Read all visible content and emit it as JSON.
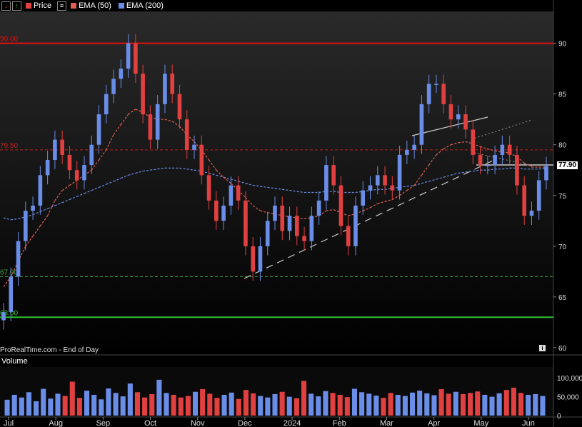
{
  "header": {
    "price_label": "Price",
    "ema50_label": "EMA (50)",
    "ema200_label": "EMA (200)",
    "colors": {
      "price": "#e04040",
      "ema50": "#e06050",
      "ema200": "#6a8de8"
    }
  },
  "volume_panel": {
    "label": "Volume",
    "ticks": [
      "100,000",
      "50,000",
      "0"
    ]
  },
  "footer": {
    "source": "ProRealTime.com - End of Day"
  },
  "levels": [
    {
      "label": "90.00",
      "value": 90.0,
      "color": "#e01010",
      "style": "solid"
    },
    {
      "label": "79.50",
      "value": 79.5,
      "color": "#c02020",
      "style": "dashed"
    },
    {
      "label": "67.00",
      "value": 67.0,
      "color": "#40a040",
      "style": "dashed"
    },
    {
      "label": "63.00",
      "value": 63.0,
      "color": "#30c030",
      "style": "solid"
    }
  ],
  "current_price": "77.90",
  "chart_data": {
    "type": "line",
    "x_labels": [
      "Jul",
      "Aug",
      "Sep",
      "Oct",
      "Nov",
      "Dec",
      "2024",
      "Feb",
      "Mar",
      "Apr",
      "May",
      "Jun"
    ],
    "y_ticks": [
      90,
      85,
      80,
      75,
      70,
      65,
      60
    ],
    "ylim": [
      59.5,
      93
    ],
    "series": [
      {
        "name": "Price",
        "color": "#e04040",
        "values": [
          63.5,
          67,
          70.5,
          73.5,
          74,
          77,
          78.5,
          80.5,
          79,
          77.5,
          76.5,
          78,
          80,
          83,
          85,
          86.5,
          87.5,
          90,
          87,
          83,
          80.5,
          84,
          87,
          85,
          82.5,
          79.5,
          80,
          77,
          74.5,
          72.5,
          74,
          76,
          74.5,
          70,
          67.5,
          70,
          72.5,
          74,
          71.5,
          73,
          71,
          70.5,
          73,
          74.5,
          78,
          76,
          72,
          70,
          74,
          75.5,
          76,
          77,
          76,
          75.5,
          79,
          79.5,
          80,
          84,
          86,
          86,
          84,
          82.5,
          83,
          81.5,
          79,
          78,
          78,
          79,
          80,
          79,
          76,
          73,
          73.5,
          76.5,
          77.9
        ]
      },
      {
        "name": "EMA (50)",
        "color": "#e06050",
        "values": [
          66,
          67,
          68.5,
          70,
          71,
          72,
          73,
          74.5,
          75.5,
          76,
          76.5,
          77,
          77.5,
          78.5,
          79.5,
          81,
          82,
          83,
          83.5,
          83.2,
          82.7,
          82.5,
          82.5,
          82.3,
          81.8,
          81,
          80.3,
          79.5,
          78.5,
          77.5,
          76.8,
          76.2,
          75.5,
          74.8,
          74,
          73.5,
          73.3,
          73.2,
          73,
          72.9,
          72.8,
          72.7,
          72.8,
          73,
          73.5,
          73.6,
          73.3,
          73,
          73.2,
          73.5,
          73.8,
          74.2,
          74.4,
          74.6,
          75,
          75.5,
          76,
          77,
          78,
          79,
          79.6,
          80,
          80.2,
          80.3,
          80.1,
          79.8,
          79.6,
          79.4,
          79.3,
          79.2,
          78.8,
          78.2,
          77.8,
          77.8,
          77.8
        ]
      },
      {
        "name": "EMA (200)",
        "color": "#6a8de8",
        "values": [
          72.8,
          72.6,
          72.7,
          72.9,
          73.1,
          73.4,
          73.7,
          74,
          74.3,
          74.6,
          74.9,
          75.2,
          75.5,
          75.8,
          76.1,
          76.4,
          76.7,
          77,
          77.2,
          77.4,
          77.5,
          77.6,
          77.7,
          77.7,
          77.7,
          77.6,
          77.5,
          77.4,
          77.2,
          77,
          76.8,
          76.6,
          76.4,
          76.2,
          76,
          75.9,
          75.8,
          75.7,
          75.6,
          75.5,
          75.4,
          75.3,
          75.3,
          75.3,
          75.4,
          75.4,
          75.3,
          75.3,
          75.3,
          75.4,
          75.5,
          75.6,
          75.6,
          75.7,
          75.8,
          75.9,
          76,
          76.2,
          76.4,
          76.6,
          76.8,
          77,
          77.2,
          77.3,
          77.4,
          77.5,
          77.5,
          77.6,
          77.6,
          77.7,
          77.7,
          77.6,
          77.6,
          77.6,
          77.7
        ]
      }
    ],
    "volume": {
      "ylim": [
        0,
        125000
      ],
      "values": [
        42000,
        55000,
        48000,
        62000,
        38000,
        71000,
        45000,
        58000,
        52000,
        90000,
        47000,
        66000,
        55000,
        43000,
        72000,
        60000,
        51000,
        85000,
        62000,
        48000,
        57000,
        95000,
        60000,
        55000,
        48000,
        52000,
        63000,
        70000,
        58000,
        47000,
        55000,
        61000,
        44000,
        68000,
        59000,
        52000,
        48000,
        57000,
        63000,
        50000,
        46000,
        92000,
        58000,
        51000,
        65000,
        60000,
        55000,
        49000,
        71000,
        62000,
        58000,
        53000,
        47000,
        60000,
        55000,
        52000,
        61000,
        66000,
        59000,
        54000,
        70000,
        58000,
        63000,
        57000,
        60000,
        64000,
        55000,
        50000,
        59000,
        68000,
        74000,
        60000,
        55000,
        57000,
        52000
      ]
    }
  }
}
